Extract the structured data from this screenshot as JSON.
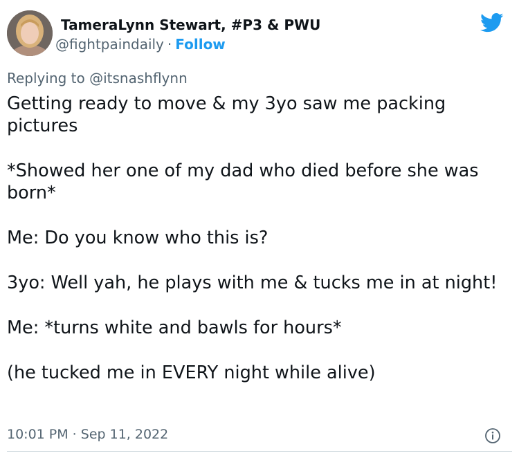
{
  "author": {
    "display_name": "TameraLynn Stewart, #P3 & PWU",
    "handle": "@fightpaindaily",
    "separator": "·",
    "follow_label": "Follow"
  },
  "reply_context": "Replying to @itsnashflynn",
  "tweet": {
    "paragraphs": [
      "Getting ready to move & my 3yo saw me packing pictures",
      "*Showed her one of my dad who died before she was born*",
      "Me: Do you know who this is?",
      "3yo: Well yah, he plays with me & tucks me in at night!",
      "Me: *turns white and bawls for hours*",
      "(he tucked me in EVERY night while alive)"
    ],
    "timestamp": "10:01 PM · Sep 11, 2022"
  },
  "icons": {
    "brand": "twitter-bird-icon",
    "info": "info-icon"
  },
  "colors": {
    "accent": "#1d9bf0",
    "secondary_text": "#536471",
    "primary_text": "#0f1419"
  }
}
